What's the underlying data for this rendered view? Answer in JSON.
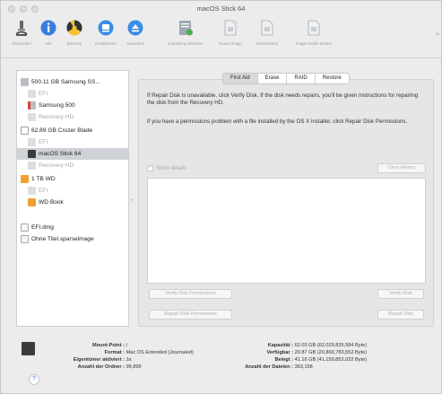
{
  "window": {
    "title": "macOS Stick 64"
  },
  "toolbar": {
    "items": [
      {
        "label": "Überprüfen",
        "icon": "microscope-icon"
      },
      {
        "label": "Info",
        "icon": "info-icon"
      },
      {
        "label": "Brennen",
        "icon": "burn-icon"
      },
      {
        "label": "Deaktivieren",
        "icon": "unmount-icon"
      },
      {
        "label": "Auswerfen",
        "icon": "eject-icon"
      },
      {
        "label": "Journaling aktivieren",
        "icon": "journal-icon"
      },
      {
        "label": "Neues Image",
        "icon": "new-image-icon"
      },
      {
        "label": "Konvertieren",
        "icon": "convert-icon"
      },
      {
        "label": "Image-Größe ändern",
        "icon": "resize-image-icon"
      }
    ],
    "overflow": "»"
  },
  "sidebar": {
    "items": [
      {
        "label": "500.11 GB Samsung SS...",
        "kind": "disk",
        "indent": 0,
        "dim": false,
        "selected": false
      },
      {
        "label": "EFI",
        "kind": "volume",
        "indent": 1,
        "dim": true,
        "selected": false
      },
      {
        "label": "Samsung 500",
        "kind": "mac-volume",
        "indent": 1,
        "dim": false,
        "selected": false
      },
      {
        "label": "Recovery HD",
        "kind": "volume",
        "indent": 1,
        "dim": true,
        "selected": false
      },
      {
        "label": "62.89 GB Cruzer Blade",
        "kind": "disk",
        "indent": 0,
        "dim": false,
        "selected": false
      },
      {
        "label": "EFI",
        "kind": "volume",
        "indent": 1,
        "dim": true,
        "selected": false
      },
      {
        "label": "macOS Stick 64",
        "kind": "volume-dark",
        "indent": 1,
        "dim": false,
        "selected": true
      },
      {
        "label": "Recovery HD",
        "kind": "volume",
        "indent": 1,
        "dim": true,
        "selected": false
      },
      {
        "label": "1 TB WD",
        "kind": "external-disk",
        "indent": 0,
        "dim": false,
        "selected": false
      },
      {
        "label": "EFI",
        "kind": "volume",
        "indent": 1,
        "dim": true,
        "selected": false
      },
      {
        "label": "WD Book",
        "kind": "external-volume",
        "indent": 1,
        "dim": false,
        "selected": false
      },
      {
        "label": "EFI.dmg",
        "kind": "image",
        "indent": 0,
        "dim": false,
        "selected": false
      },
      {
        "label": "Ohne Titel.sparseimage",
        "kind": "image",
        "indent": 0,
        "dim": false,
        "selected": false
      }
    ]
  },
  "tabs": [
    {
      "label": "First Aid",
      "active": true
    },
    {
      "label": "Erase",
      "active": false
    },
    {
      "label": "RAID",
      "active": false
    },
    {
      "label": "Restore",
      "active": false
    }
  ],
  "firstaid": {
    "para1": "If Repair Disk is unavailable, click Verify Disk. If the disk needs repairs, you'll be given instructions for repairing the disk from the Recovery HD.",
    "para2": "If you have a permissions problem with a file installed by the OS X installer, click Repair Disk Permissions.",
    "show_details": "Show details",
    "clear_history": "Clear History",
    "verify_perms": "Verify Disk Permissions",
    "repair_perms": "Repair Disk Permissions",
    "verify_disk": "Verify Disk",
    "repair_disk": "Repair Disk"
  },
  "info": {
    "mount_point_k": "Mount-Point :",
    "mount_point_v": "/",
    "format_k": "Format :",
    "format_v": "Mac OS Extended (Journaled)",
    "owners_k": "Eigentümer aktiviert :",
    "owners_v": "Ja",
    "folders_k": "Anzahl der Ordner :",
    "folders_v": "99,899",
    "capacity_k": "Kapazität :",
    "capacity_v": "62.03 GB (62,029,835,584 Byte)",
    "available_k": "Verfügbar :",
    "available_v": "20.87 GB (20,869,783,552 Byte)",
    "used_k": "Belegt :",
    "used_v": "41.16 GB (41,159,852,032 Byte)",
    "files_k": "Anzahl der Dateien :",
    "files_v": "363,198"
  },
  "help": "?",
  "colors": {
    "selection": "#cfd2d6",
    "accent": "#3b7bd8",
    "window": "#ececec"
  }
}
